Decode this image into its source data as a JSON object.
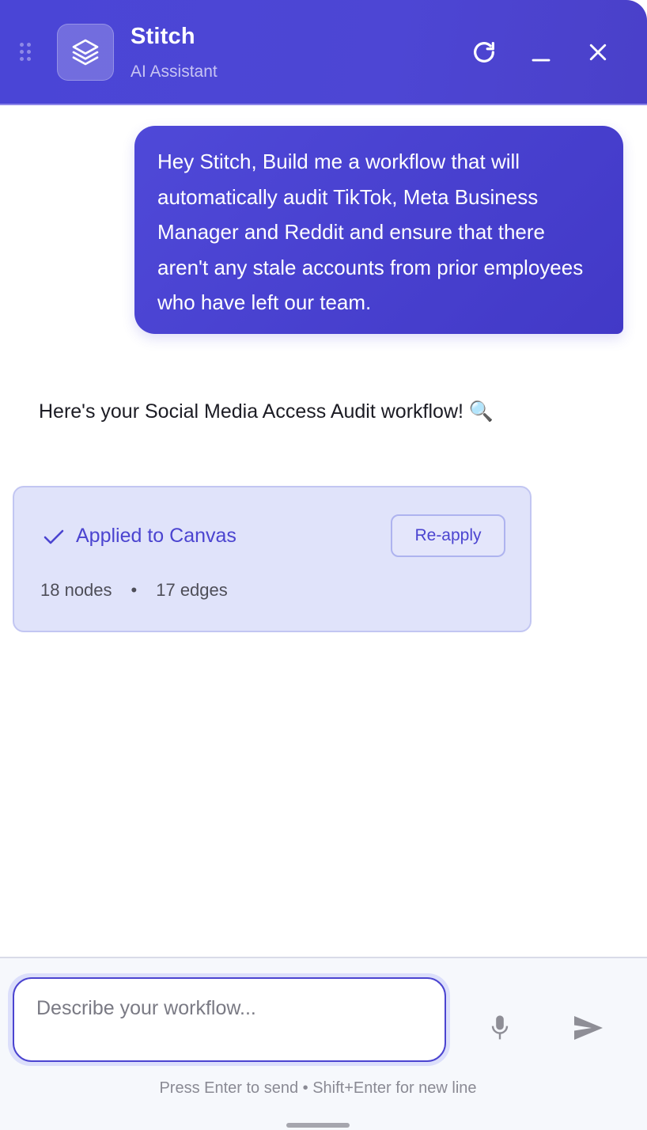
{
  "header": {
    "title": "Stitch",
    "subtitle": "AI Assistant",
    "icons": {
      "drag": "drag-handle-icon",
      "app": "layers-icon",
      "refresh": "refresh-icon",
      "minimize": "minimize-icon",
      "close": "close-icon"
    }
  },
  "chat": {
    "user_message": "Hey Stitch, Build me a workflow that will automatically audit TikTok, Meta Business Manager and Reddit and ensure that there aren't any stale accounts from prior employees who have left our team.",
    "assistant_message": "Here's your Social Media Access Audit workflow! 🔍",
    "status_card": {
      "applied_label": "Applied to Canvas",
      "reapply_label": "Re-apply",
      "nodes": "18 nodes",
      "separator": "•",
      "edges": "17 edges"
    }
  },
  "composer": {
    "placeholder": "Describe your workflow...",
    "value": "",
    "hint": "Press Enter to send • Shift+Enter for new line",
    "icons": {
      "mic": "microphone-icon",
      "send": "send-icon"
    }
  },
  "colors": {
    "accent": "#4b44d0",
    "header_bg": "#4a45d6",
    "card_bg": "#e0e3fa"
  }
}
